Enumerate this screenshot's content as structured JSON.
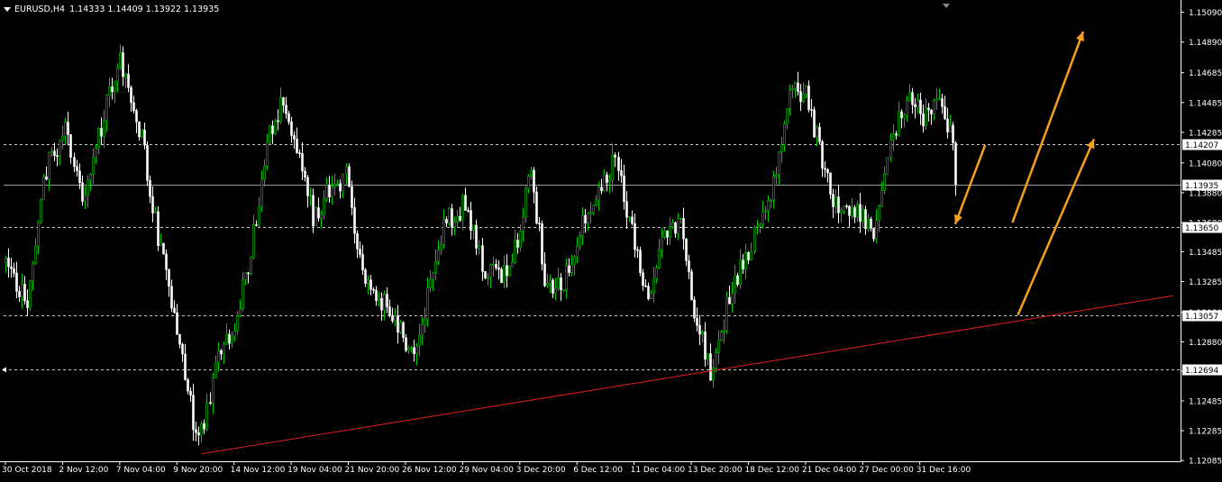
{
  "header": {
    "symbol_timeframe": "EURUSD,H4",
    "ohlc": "1.14333 1.14409 1.13922 1.13935"
  },
  "colors": {
    "background": "#000000",
    "bull_candle": "#00c800",
    "bear_candle": "#ffffff",
    "axis": "#ffffff",
    "grid_line": "#c8c8c8",
    "trendline": "#e0201c",
    "arrow": "#f5a01e"
  },
  "chart_data": {
    "type": "candlestick",
    "title": "",
    "symbol": "EURUSD",
    "timeframe": "H4",
    "ylim": [
      1.1208,
      1.1516
    ],
    "y_ticks": [
      "1.15090",
      "1.14890",
      "1.14685",
      "1.14485",
      "1.14285",
      "1.14080",
      "1.13880",
      "1.13680",
      "1.13485",
      "1.13285",
      "1.13080",
      "1.12880",
      "1.12685",
      "1.12485",
      "1.12285",
      "1.12085"
    ],
    "x_tick_labels": [
      "30 Oct 2018",
      "2 Nov 12:00",
      "7 Nov 04:00",
      "9 Nov 20:00",
      "14 Nov 12:00",
      "19 Nov 04:00",
      "21 Nov 20:00",
      "26 Nov 12:00",
      "29 Nov 04:00",
      "3 Dec 20:00",
      "6 Dec 12:00",
      "11 Dec 04:00",
      "13 Dec 20:00",
      "18 Dec 12:00",
      "21 Dec 04:00",
      "27 Dec 00:00",
      "31 Dec 16:00"
    ],
    "current_price": "1.13935",
    "horizontal_levels": [
      "1.14207",
      "1.13650",
      "1.13057",
      "1.12694"
    ],
    "close_path": [
      {
        "bar": 0,
        "close": 1.1345
      },
      {
        "bar": 8,
        "close": 1.131
      },
      {
        "bar": 14,
        "close": 1.14
      },
      {
        "bar": 22,
        "close": 1.143
      },
      {
        "bar": 28,
        "close": 1.138
      },
      {
        "bar": 36,
        "close": 1.144
      },
      {
        "bar": 42,
        "close": 1.1475
      },
      {
        "bar": 50,
        "close": 1.1425
      },
      {
        "bar": 56,
        "close": 1.136
      },
      {
        "bar": 62,
        "close": 1.131
      },
      {
        "bar": 67,
        "close": 1.1255
      },
      {
        "bar": 71,
        "close": 1.1218
      },
      {
        "bar": 78,
        "close": 1.128
      },
      {
        "bar": 84,
        "close": 1.13
      },
      {
        "bar": 90,
        "close": 1.135
      },
      {
        "bar": 96,
        "close": 1.142
      },
      {
        "bar": 102,
        "close": 1.145
      },
      {
        "bar": 107,
        "close": 1.142
      },
      {
        "bar": 113,
        "close": 1.137
      },
      {
        "bar": 119,
        "close": 1.139
      },
      {
        "bar": 125,
        "close": 1.14
      },
      {
        "bar": 131,
        "close": 1.133
      },
      {
        "bar": 137,
        "close": 1.132
      },
      {
        "bar": 143,
        "close": 1.13
      },
      {
        "bar": 150,
        "close": 1.128
      },
      {
        "bar": 156,
        "close": 1.1325
      },
      {
        "bar": 162,
        "close": 1.137
      },
      {
        "bar": 169,
        "close": 1.138
      },
      {
        "bar": 175,
        "close": 1.134
      },
      {
        "bar": 181,
        "close": 1.133
      },
      {
        "bar": 187,
        "close": 1.135
      },
      {
        "bar": 193,
        "close": 1.14
      },
      {
        "bar": 199,
        "close": 1.132
      },
      {
        "bar": 205,
        "close": 1.133
      },
      {
        "bar": 212,
        "close": 1.137
      },
      {
        "bar": 218,
        "close": 1.139
      },
      {
        "bar": 224,
        "close": 1.141
      },
      {
        "bar": 230,
        "close": 1.136
      },
      {
        "bar": 236,
        "close": 1.131
      },
      {
        "bar": 242,
        "close": 1.136
      },
      {
        "bar": 248,
        "close": 1.137
      },
      {
        "bar": 254,
        "close": 1.13
      },
      {
        "bar": 259,
        "close": 1.127
      },
      {
        "bar": 265,
        "close": 1.131
      },
      {
        "bar": 271,
        "close": 1.134
      },
      {
        "bar": 277,
        "close": 1.137
      },
      {
        "bar": 283,
        "close": 1.14
      },
      {
        "bar": 289,
        "close": 1.146
      },
      {
        "bar": 295,
        "close": 1.145
      },
      {
        "bar": 301,
        "close": 1.14
      },
      {
        "bar": 307,
        "close": 1.137
      },
      {
        "bar": 313,
        "close": 1.138
      },
      {
        "bar": 319,
        "close": 1.136
      },
      {
        "bar": 325,
        "close": 1.142
      },
      {
        "bar": 331,
        "close": 1.145
      },
      {
        "bar": 337,
        "close": 1.144
      },
      {
        "bar": 343,
        "close": 1.1445
      },
      {
        "bar": 347,
        "close": 1.14333
      },
      {
        "bar": 349,
        "close": 1.13935
      }
    ],
    "trendline": {
      "from": {
        "bar": 72,
        "price": 1.1213
      },
      "to": {
        "bar": 429,
        "price": 1.1319
      }
    },
    "arrows": [
      {
        "from": {
          "bar": 360,
          "price": 1.142
        },
        "to": {
          "bar": 349,
          "price": 1.1367
        }
      },
      {
        "from": {
          "bar": 370,
          "price": 1.1368
        },
        "to": {
          "bar": 396,
          "price": 1.1496
        }
      },
      {
        "from": {
          "bar": 372,
          "price": 1.1306
        },
        "to": {
          "bar": 400,
          "price": 1.1424
        }
      }
    ]
  }
}
